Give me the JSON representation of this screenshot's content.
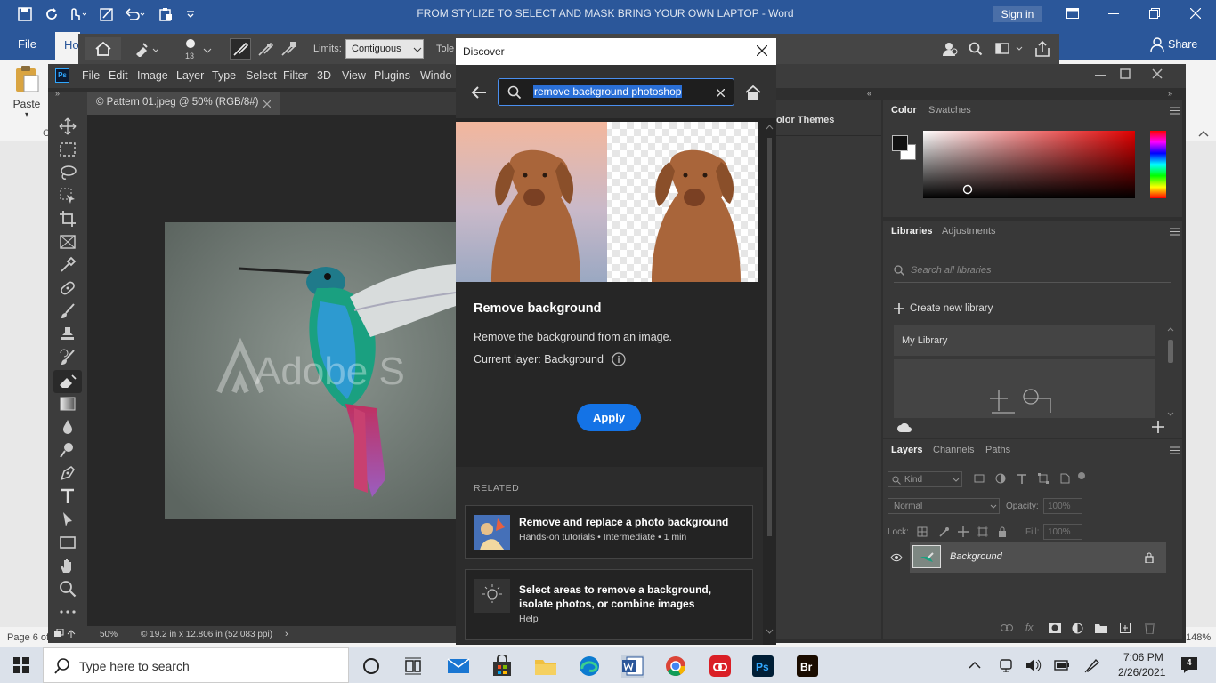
{
  "word": {
    "title": "FROM STYLIZE TO SELECT AND MASK BRING YOUR OWN LAPTOP  -  Word",
    "sign_in": "Sign in",
    "share": "Share",
    "tabs": {
      "file": "File",
      "home": "Ho"
    },
    "paste": "Paste",
    "page_status": "Page 6 of",
    "zoom": "148%",
    "clipboard_letter": "C"
  },
  "photoshop": {
    "options": {
      "limits_label": "Limits:",
      "limits_value": "Contiguous",
      "tolerance_label": "Tole",
      "brush_size": "13"
    },
    "menu": [
      "File",
      "Edit",
      "Image",
      "Layer",
      "Type",
      "Select",
      "Filter",
      "3D",
      "View",
      "Plugins",
      "Windo"
    ],
    "doc_tab": "© Pattern 01.jpeg @ 50% (RGB/8#)",
    "watermark": "Adobe S",
    "status": {
      "zoom": "50%",
      "info": "© 19.2 in x 12.806 in (52.083 ppi)"
    },
    "color_panel": {
      "tab_color": "Color",
      "tab_swatches": "Swatches",
      "color_themes": "olor Themes"
    },
    "libraries_panel": {
      "tab_libraries": "Libraries",
      "tab_adjustments": "Adjustments",
      "search_placeholder": "Search all libraries",
      "create": "Create new library",
      "my_library": "My Library"
    },
    "layers_panel": {
      "tab_layers": "Layers",
      "tab_channels": "Channels",
      "tab_paths": "Paths",
      "kind": "Kind",
      "blend_mode": "Normal",
      "opacity_label": "Opacity:",
      "opacity": "100%",
      "lock_label": "Lock:",
      "fill_label": "Fill:",
      "fill": "100%",
      "layer_name": "Background"
    }
  },
  "discover": {
    "title": "Discover",
    "search_value": "remove background photoshop",
    "result_title": "Remove background",
    "result_desc": "Remove the background from an image.",
    "current_layer": "Current layer: Background",
    "apply": "Apply",
    "related_heading": "RELATED",
    "related": [
      {
        "title": "Remove and replace a photo background",
        "meta": "Hands-on tutorials  •  Intermediate  •  1 min"
      },
      {
        "title": "Select areas to remove a background, isolate photos, or combine images",
        "meta": "Help"
      }
    ]
  },
  "taskbar": {
    "search_placeholder": "Type here to search",
    "time": "7:06 PM",
    "date": "2/26/2021",
    "notification_count": "4"
  },
  "colors": {
    "word_blue": "#2b579a",
    "ps_dark": "#3c3c3c",
    "apply_blue": "#1473e6",
    "selection": "#2a6fd6"
  }
}
